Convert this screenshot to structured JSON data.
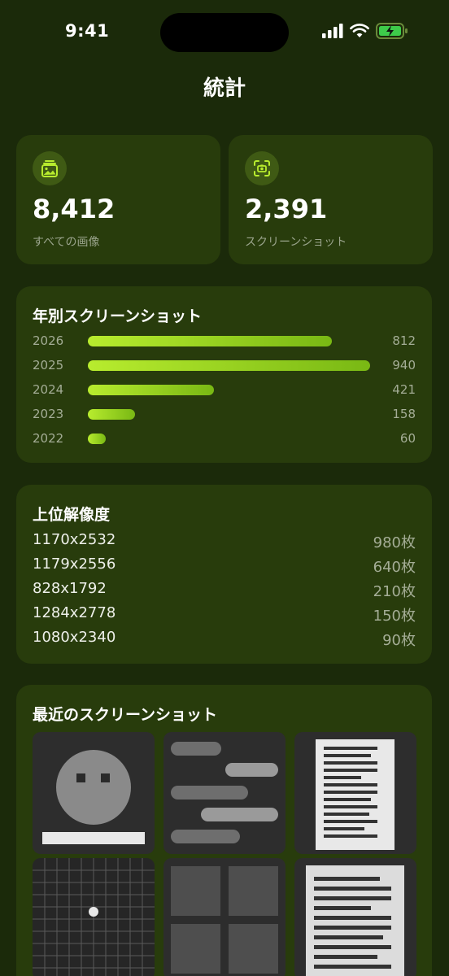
{
  "status_bar": {
    "time": "9:41"
  },
  "header": {
    "title": "統計"
  },
  "stats": [
    {
      "value": "8,412",
      "label": "すべての画像",
      "icon": "photo-icon"
    },
    {
      "value": "2,391",
      "label": "スクリーンショット",
      "icon": "screenshot-icon"
    }
  ],
  "yearly": {
    "title": "年別スクリーンショット",
    "rows": [
      {
        "year": "2026",
        "count": "812"
      },
      {
        "year": "2025",
        "count": "940"
      },
      {
        "year": "2024",
        "count": "421"
      },
      {
        "year": "2023",
        "count": "158"
      },
      {
        "year": "2022",
        "count": "60"
      }
    ]
  },
  "resolutions": {
    "title": "上位解像度",
    "rows": [
      {
        "name": "1170x2532",
        "count": "980枚"
      },
      {
        "name": "1179x2556",
        "count": "640枚"
      },
      {
        "name": "828x1792",
        "count": "210枚"
      },
      {
        "name": "1284x2778",
        "count": "150枚"
      },
      {
        "name": "1080x2340",
        "count": "90枚"
      }
    ]
  },
  "recent": {
    "title": "最近のスクリーンショット",
    "items": [
      {
        "kind": "face"
      },
      {
        "kind": "chat"
      },
      {
        "kind": "document"
      },
      {
        "kind": "map"
      },
      {
        "kind": "grid"
      },
      {
        "kind": "document"
      }
    ]
  },
  "colors": {
    "background": "#1b2a0a",
    "card": "#283c0c",
    "accent": "#b8ec2e",
    "accent_dark": "#79b814"
  }
}
